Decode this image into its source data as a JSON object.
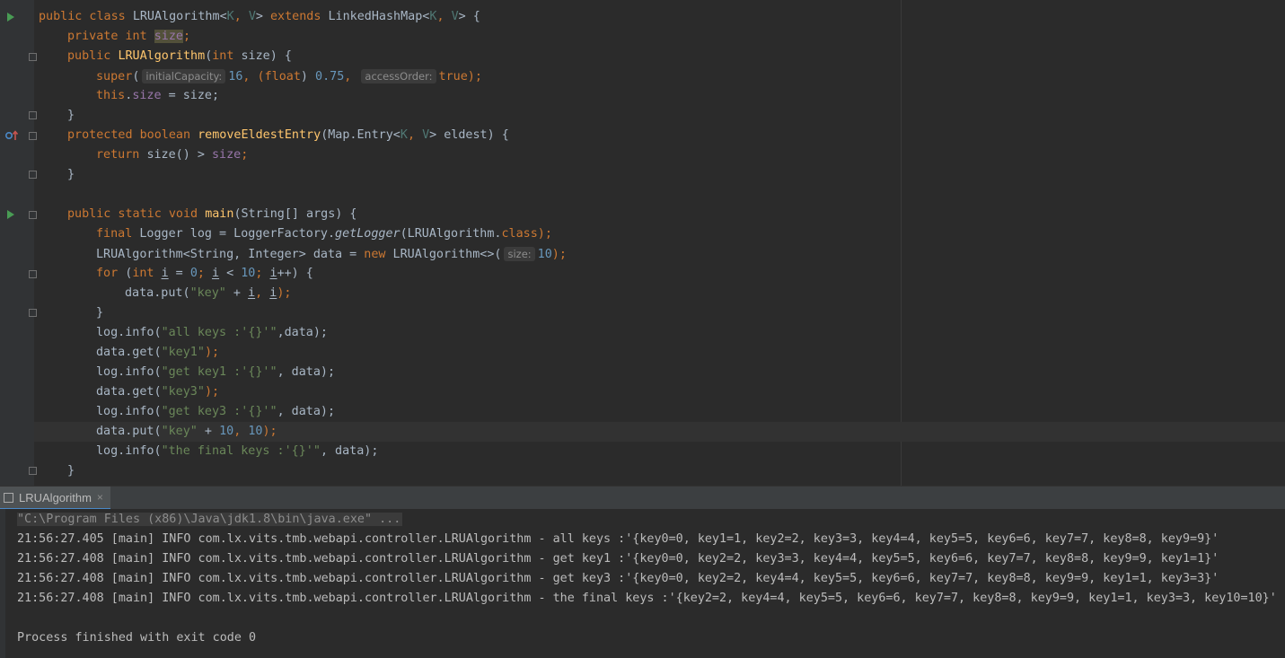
{
  "editor": {
    "code": {
      "l1_kw1": "public class ",
      "l1_class": "LRUAlgorithm",
      "l1_lt": "<",
      "l1_k": "K",
      "l1_comma": ", ",
      "l1_v": "V",
      "l1_gt": "> ",
      "l1_kw2": "extends ",
      "l1_base": "LinkedHashMap<",
      "l1_k2": "K",
      "l1_comma2": ", ",
      "l1_v2": "V",
      "l1_end": "> {",
      "l2_kw": "private int ",
      "l2_field": "size",
      "l2_end": ";",
      "l3_kw": "public ",
      "l3_fn": "LRUAlgorithm",
      "l3_p1": "(",
      "l3_kw2": "int ",
      "l3_p2": "size) {",
      "l4_kw": "super",
      "l4_p1": "(",
      "l4_hint1": "initialCapacity:",
      "l4_n1": "16",
      "l4_p2": ", (",
      "l4_kw2": "float",
      "l4_p3": ") ",
      "l4_n2": "0.75",
      "l4_p4": ", ",
      "l4_hint2": "accessOrder:",
      "l4_kw3": "true",
      "l4_p5": ");",
      "l5_kw": "this",
      "l5_dot": ".",
      "l5_field": "size",
      "l5_end": " = size;",
      "l6": "}",
      "l7_kw": "protected boolean ",
      "l7_fn": "removeEldestEntry",
      "l7_p1": "(Map.Entry<",
      "l7_k": "K",
      "l7_comma": ", ",
      "l7_v": "V",
      "l7_end": "> eldest) {",
      "l8_kw": "return ",
      "l8_p1": "size() > ",
      "l8_field": "size",
      "l8_end": ";",
      "l9": "}",
      "l10_kw": "public static void ",
      "l10_fn": "main",
      "l10_end": "(String[] args) {",
      "l11_kw": "final ",
      "l11_p1": "Logger log = LoggerFactory.",
      "l11_method": "getLogger",
      "l11_p2": "(LRUAlgorithm.",
      "l11_kw2": "class",
      "l11_end": ");",
      "l12_p1": "LRUAlgorithm<String, Integer> data = ",
      "l12_kw": "new ",
      "l12_p2": "LRUAlgorithm<>(",
      "l12_hint": "size:",
      "l12_num": "10",
      "l12_end": ");",
      "l13_kw": "for ",
      "l13_p1": "(",
      "l13_kw2": "int ",
      "l13_i1": "i",
      "l13_p2": " = ",
      "l13_n1": "0",
      "l13_p3": "; ",
      "l13_i2": "i",
      "l13_p4": " < ",
      "l13_n2": "10",
      "l13_p5": "; ",
      "l13_i3": "i",
      "l13_end": "++) {",
      "l14_p1": "data.put(",
      "l14_str": "\"key\"",
      "l14_p2": " + ",
      "l14_i1": "i",
      "l14_p3": ", ",
      "l14_i2": "i",
      "l14_end": ");",
      "l15": "}",
      "l16_p1": "log.info(",
      "l16_str": "\"all keys :'{}'\"",
      "l16_end": ",data);",
      "l17_p1": "data.get(",
      "l17_str": "\"key1\"",
      "l17_end": ");",
      "l18_p1": "log.info(",
      "l18_str": "\"get key1 :'{}'\"",
      "l18_end": ", data);",
      "l19_p1": "data.get(",
      "l19_str": "\"key3\"",
      "l19_end": ");",
      "l20_p1": "log.info(",
      "l20_str": "\"get key3 :'{}'\"",
      "l20_end": ", data);",
      "l21_p1": "data.put(",
      "l21_str": "\"key\"",
      "l21_p2": " + ",
      "l21_n1": "10",
      "l21_p3": ", ",
      "l21_n2": "10",
      "l21_end": ");",
      "l22_p1": "log.info(",
      "l22_str": "\"the final keys :'{}'\"",
      "l22_end": ", data);",
      "l23": "}"
    }
  },
  "run_panel": {
    "tab_label": "LRUAlgorithm",
    "tab_close": "×",
    "console": [
      "\"C:\\Program Files (x86)\\Java\\jdk1.8\\bin\\java.exe\" ...",
      "21:56:27.405 [main] INFO com.lx.vits.tmb.webapi.controller.LRUAlgorithm - all keys :'{key0=0, key1=1, key2=2, key3=3, key4=4, key5=5, key6=6, key7=7, key8=8, key9=9}'",
      "21:56:27.408 [main] INFO com.lx.vits.tmb.webapi.controller.LRUAlgorithm - get key1 :'{key0=0, key2=2, key3=3, key4=4, key5=5, key6=6, key7=7, key8=8, key9=9, key1=1}'",
      "21:56:27.408 [main] INFO com.lx.vits.tmb.webapi.controller.LRUAlgorithm - get key3 :'{key0=0, key2=2, key4=4, key5=5, key6=6, key7=7, key8=8, key9=9, key1=1, key3=3}'",
      "21:56:27.408 [main] INFO com.lx.vits.tmb.webapi.controller.LRUAlgorithm - the final keys :'{key2=2, key4=4, key5=5, key6=6, key7=7, key8=8, key9=9, key1=1, key3=3, key10=10}'",
      "Process finished with exit code 0"
    ]
  },
  "colors": {
    "background": "#2b2b2b",
    "gutter": "#313335",
    "keyword": "#cc7832",
    "function": "#ffc66d",
    "field": "#9876aa",
    "string": "#6a8759",
    "number": "#6897bb",
    "run_icon": "#499c54"
  },
  "icons": [
    "run-icon",
    "fold-icon",
    "override-icon",
    "close-icon"
  ]
}
